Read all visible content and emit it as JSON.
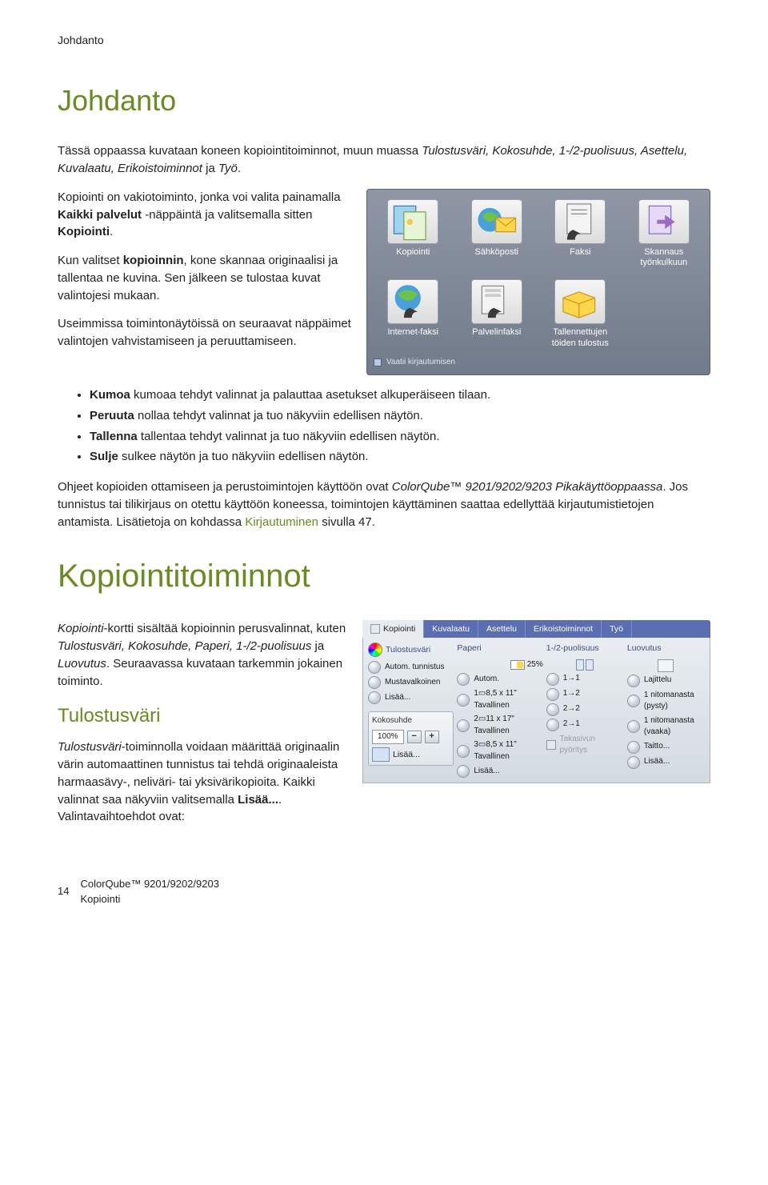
{
  "header_small": "Johdanto",
  "h1_johdanto": "Johdanto",
  "intro_para_pre": "Tässä oppaassa kuvataan koneen kopiointitoiminnot, muun muassa ",
  "intro_terms": "Tulostusväri, Kokosuhde, 1-/2-puolisuus, Asettelu, Kuvalaatu, Erikoistoiminnot",
  "intro_para_post": " ja ",
  "intro_last_term": "Työ",
  "intro_end": ".",
  "p2a": "Kopiointi on vakiotoiminto, jonka voi valita painamalla ",
  "p2a_b1": "Kaikki palvelut",
  "p2a_mid": " -näppäintä ja valitsemalla sitten ",
  "p2a_b2": "Kopiointi",
  "p2a_end": ".",
  "p2b_pre": "Kun valitset ",
  "p2b_b": "kopioinnin",
  "p2b_post": ", kone skannaa originaalisi ja tallentaa ne kuvina. Sen jälkeen se tulostaa kuvat valintojesi mukaan.",
  "p2c": "Useimmissa toimintonäytöissä on seuraavat näppäimet valintojen vahvistamiseen ja peruuttamiseen.",
  "panel1_cells": [
    {
      "label": "Kopiointi",
      "kind": "copy"
    },
    {
      "label": "Sähköposti",
      "kind": "mail"
    },
    {
      "label": "Faksi",
      "kind": "fax"
    },
    {
      "label": "Skannaus työnkulkuun",
      "kind": "scan"
    },
    {
      "label": "Internet-faksi",
      "kind": "ifax"
    },
    {
      "label": "Palvelinfaksi",
      "kind": "sfax"
    },
    {
      "label": "Tallennettujen töiden tulostus",
      "kind": "print"
    }
  ],
  "panel1_foot": "Vaatii kirjautumisen",
  "bullets": [
    {
      "b": "Kumoa",
      "t": " kumoaa tehdyt valinnat ja palauttaa asetukset alkuperäiseen tilaan."
    },
    {
      "b": "Peruuta",
      "t": " nollaa tehdyt valinnat ja tuo näkyviin edellisen näytön."
    },
    {
      "b": "Tallenna",
      "t": "  tallentaa tehdyt valinnat ja tuo näkyviin edellisen näytön."
    },
    {
      "b": "Sulje",
      "t": " sulkee näytön ja tuo näkyviin edellisen näytön."
    }
  ],
  "ohje_p_pre": "Ohjeet kopioiden ottamiseen ja perustoimintojen käyttöön ovat ",
  "ohje_em1": "ColorQube™ 9201/9202/9203 Pikakäyttöoppaassa",
  "ohje_p_mid": ". Jos tunnistus tai tilikirjaus on otettu käyttöön koneessa, toimintojen käyttäminen saattaa edellyttää kirjautumistietojen antamista. Lisätietoja on kohdassa ",
  "ohje_link": "Kirjautuminen",
  "ohje_p_post": " sivulla 47.",
  "h1_kopioint": "Kopiointitoiminnot",
  "kortti_p_em": "Kopiointi",
  "kortti_p_pre": "-kortti sisältää kopioinnin perusvalinnat, kuten ",
  "kortti_terms": "Tulostusväri, Kokosuhde, Paperi, 1-/2-puolisuus",
  "kortti_mid": " ja ",
  "kortti_last": "Luovutus",
  "kortti_end": ". Seuraavassa kuvataan tarkemmin jokainen toiminto.",
  "h2_tulostus": "Tulostusväri",
  "tul_em": "Tulostusväri",
  "tul_p": "-toiminnolla voidaan määrittää originaalin värin automaattinen tunnistus tai tehdä originaaleista harmaasävy-, neliväri- tai yksivärikopioita. Kaikki valinnat saa näkyviin valitsemalla ",
  "tul_b": "Lisää...",
  "tul_end": ". Valintavaihtoehdot ovat:",
  "panel2": {
    "tabs": [
      "Kopiointi",
      "Kuvalaatu",
      "Asettelu",
      "Erikoistoiminnot",
      "Työ"
    ],
    "col1": {
      "head": "Tulostusväri",
      "opts": [
        "Autom. tunnistus",
        "Mustavalkoinen",
        "Lisää..."
      ],
      "koko_h": "Kokosuhde",
      "koko_v": "100%",
      "lisa": "Lisää..."
    },
    "col2": {
      "head": "Paperi",
      "top": "25%",
      "opts": [
        "Autom.",
        "1▭8,5 x 11\" Tavallinen",
        "2▭11 x 17\" Tavallinen",
        "3▭8,5 x 11\" Tavallinen",
        "Lisää..."
      ]
    },
    "col3": {
      "head": "1-/2-puolisuus",
      "opts": [
        "1→1",
        "1→2",
        "2→2",
        "2→1"
      ],
      "foot": "Takasivun pyöritys"
    },
    "col4": {
      "head": "Luovutus",
      "opts": [
        "Lajittelu",
        "1 nitomanasta (pysty)",
        "1 nitomanasta (vaaka)",
        "Taitto...",
        "Lisää..."
      ]
    }
  },
  "footer_page": "14",
  "footer_model": "ColorQube™ 9201/9202/9203",
  "footer_sub": "Kopiointi"
}
